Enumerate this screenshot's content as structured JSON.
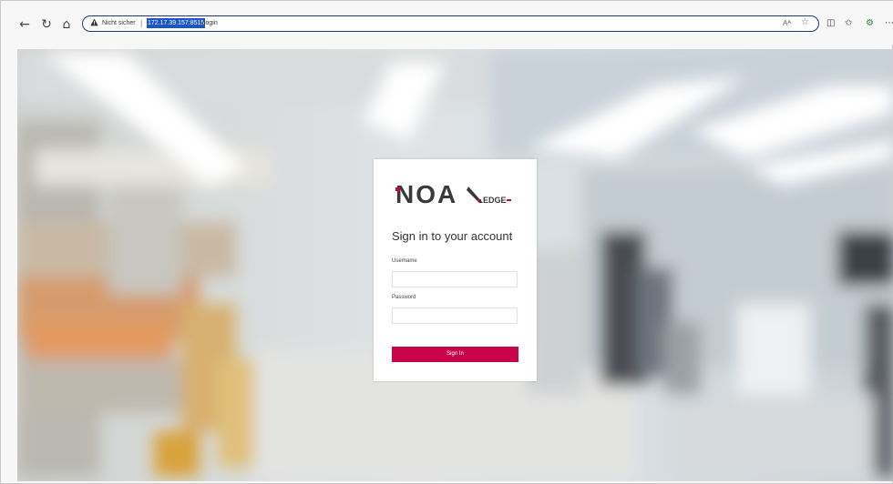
{
  "browser": {
    "security_label": "Nicht sicher",
    "separator": "|",
    "url_host": "172.17.39.157:8515",
    "url_path": "/login",
    "reader_label": "Aᴬ"
  },
  "login": {
    "logo_main": "NOA",
    "logo_sub": "EDGE",
    "title": "Sign in to your account",
    "username_label": "Username",
    "username_value": "",
    "password_label": "Password",
    "password_value": "",
    "submit_label": "Sign In"
  },
  "colors": {
    "accent": "#c8054a",
    "logo_dark": "#3a3a3a",
    "address_border": "#1f3b73",
    "url_highlight": "#1a56c8"
  },
  "icons": [
    "back-icon",
    "refresh-icon",
    "home-icon",
    "warning-icon",
    "read-aloud-icon",
    "favorite-star-icon",
    "split-screen-icon",
    "favorites-icon",
    "extension-icon",
    "more-icon"
  ]
}
